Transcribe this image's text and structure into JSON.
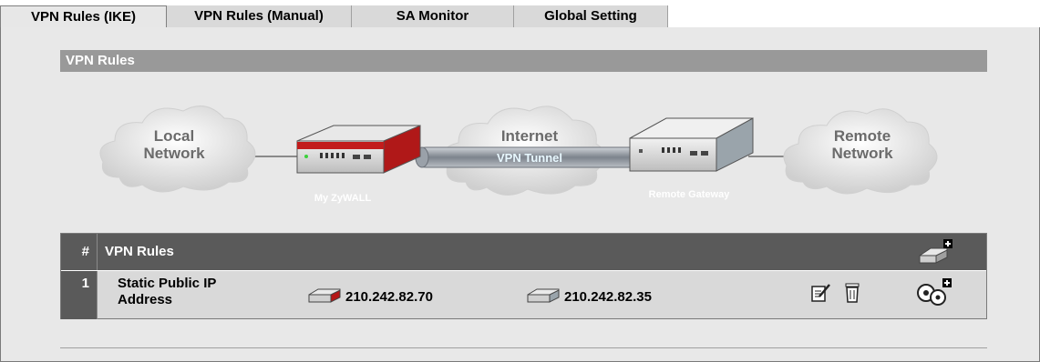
{
  "tabs": [
    {
      "label": "VPN Rules (IKE)",
      "active": true
    },
    {
      "label": "VPN Rules (Manual)",
      "active": false
    },
    {
      "label": "SA Monitor",
      "active": false
    },
    {
      "label": "Global Setting",
      "active": false
    }
  ],
  "section": {
    "title": "VPN Rules"
  },
  "diagram": {
    "local_network_line1": "Local",
    "local_network_line2": "Network",
    "internet": "Internet",
    "vpn_tunnel": "VPN Tunnel",
    "my_device": "My ZyWALL",
    "remote_gateway": "Remote Gateway",
    "remote_network_line1": "Remote",
    "remote_network_line2": "Network"
  },
  "table": {
    "header_num": "#",
    "header_rules": "VPN Rules",
    "rows": [
      {
        "num": "1",
        "name_line1": "Static Public IP",
        "name_line2": "Address",
        "local_ip": "210.242.82.70",
        "remote_ip": "210.242.82.35"
      }
    ]
  },
  "icons": {
    "add_gateway": "add-gateway-policy-icon",
    "edit": "edit-icon",
    "delete": "delete-icon",
    "add_network": "add-network-policy-icon"
  }
}
